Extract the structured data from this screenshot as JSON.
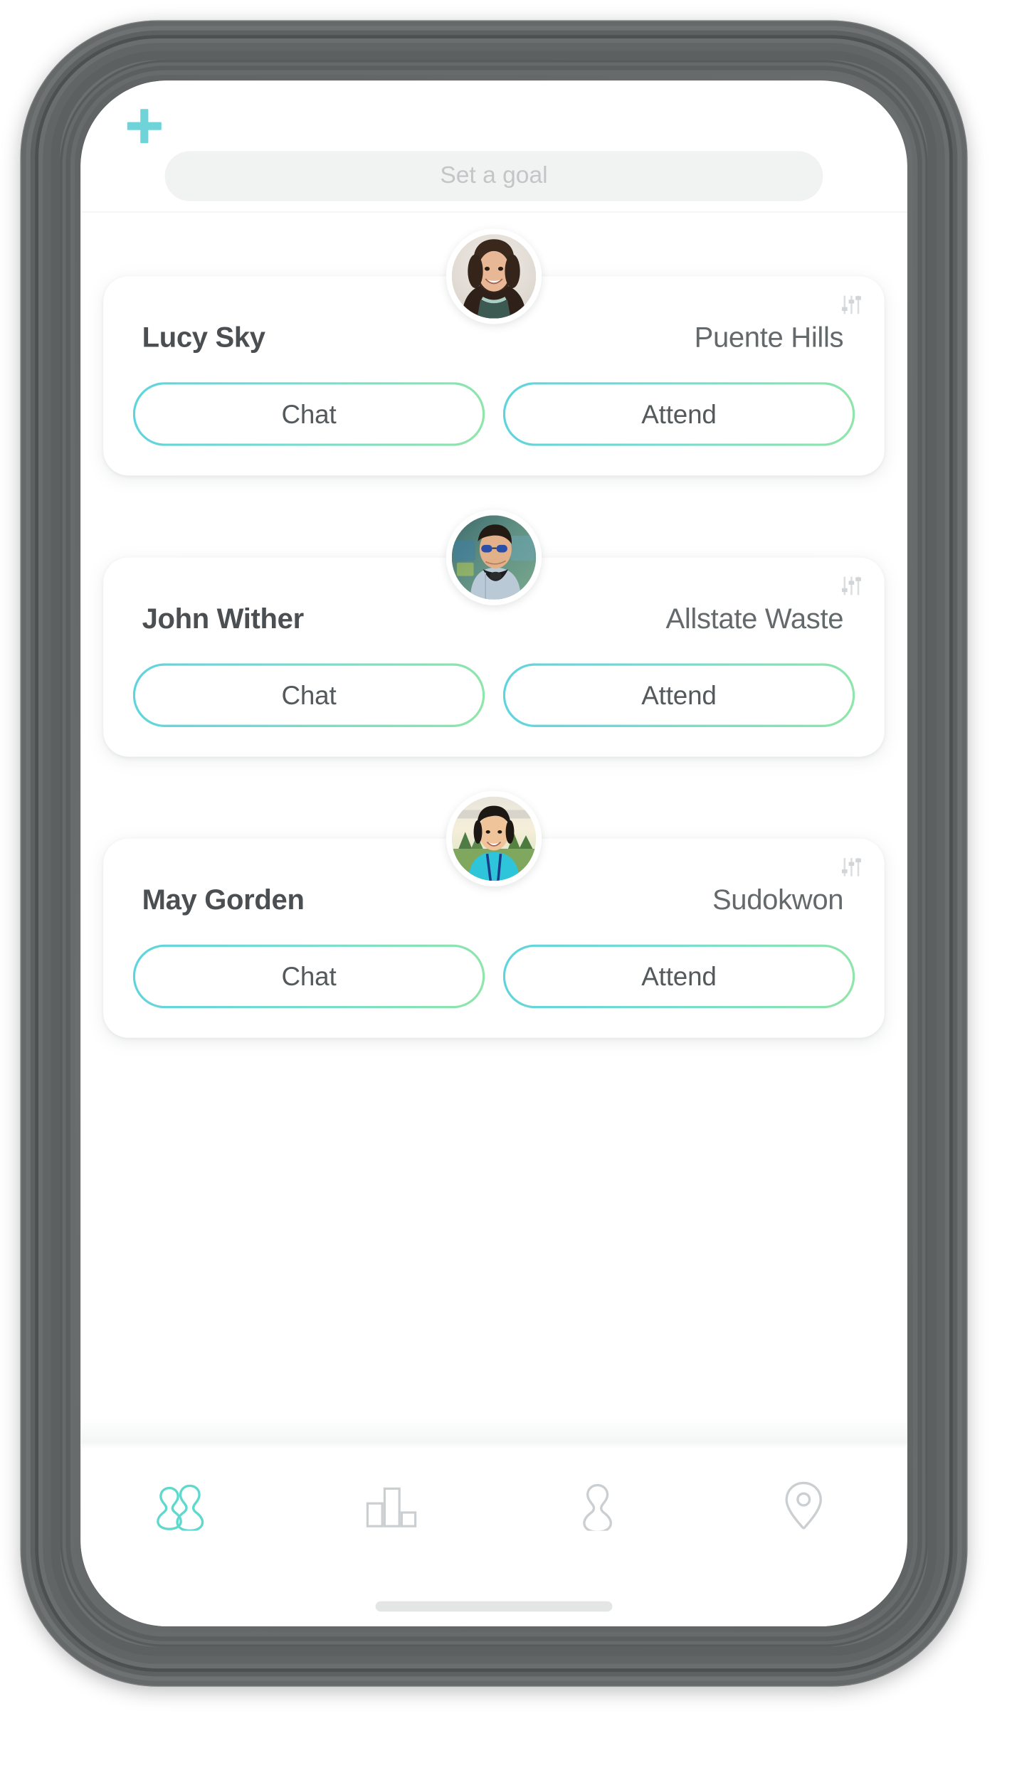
{
  "theme": {
    "accent_teal": "#6ed4d9",
    "accent_green": "#8fe6a8",
    "frame_gray": "#6b6f6f",
    "screen_bg": "#ffffff",
    "field_bg": "#f1f2f2",
    "muted_text": "#c3c6c7",
    "name_text": "#4b4f52",
    "place_text": "#64696c"
  },
  "header": {
    "add_button": {
      "label": "+",
      "icon": "plus-icon"
    },
    "goal_input": {
      "value": "",
      "placeholder": "Set a goal"
    }
  },
  "feed": {
    "cards": [
      {
        "name": "Lucy Sky",
        "place": "Puente Hills",
        "menu_icon": "sliders-icon",
        "avatar": "woman-curly-hair-smiling",
        "actions": {
          "chat": "Chat",
          "attend": "Attend"
        }
      },
      {
        "name": "John Wither",
        "place": "Allstate Waste",
        "menu_icon": "sliders-icon",
        "avatar": "man-sunglasses-headphones",
        "actions": {
          "chat": "Chat",
          "attend": "Attend"
        }
      },
      {
        "name": "May Gorden",
        "place": "Sudokwon",
        "menu_icon": "sliders-icon",
        "avatar": "person-teal-shirt-lanyard",
        "actions": {
          "chat": "Chat",
          "attend": "Attend"
        }
      }
    ]
  },
  "tabbar": {
    "items": [
      {
        "icon": "people-group-icon",
        "active": true
      },
      {
        "icon": "bar-chart-icon",
        "active": false
      },
      {
        "icon": "person-icon",
        "active": false
      },
      {
        "icon": "location-pin-icon",
        "active": false
      }
    ]
  },
  "system": {
    "home_indicator": true
  }
}
